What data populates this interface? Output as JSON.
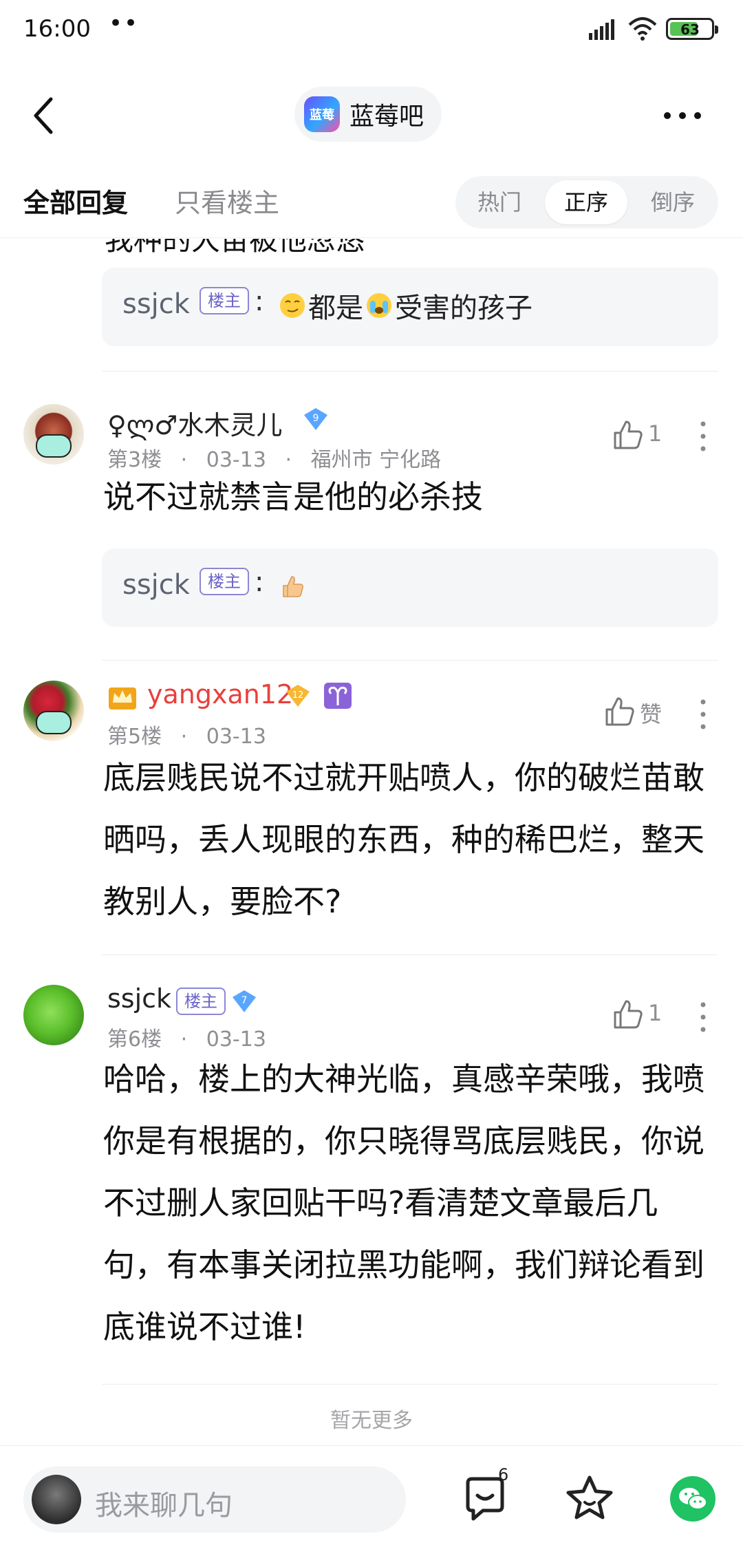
{
  "status_bar": {
    "time": "16:00",
    "dots": "••",
    "battery": "63"
  },
  "nav": {
    "forum_name": "蓝莓吧",
    "forum_logo_text": "蓝莓"
  },
  "filter": {
    "tab_all": "全部回复",
    "tab_op_only": "只看楼主",
    "sort_hot": "热门",
    "sort_asc": "正序",
    "sort_desc": "倒序"
  },
  "clipped_text": "我种的大苗被他忽悠",
  "op_badge": "楼主",
  "reply_1": {
    "author": "ssjck",
    "colon": ":",
    "text_a": "都是",
    "text_b": "受害的孩子"
  },
  "post_3": {
    "username": "♀ლ♂水木灵儿",
    "level": "9",
    "floor": "第3楼",
    "sep": "·",
    "date": "03-13",
    "location": "福州市 宁化路",
    "likes": "1",
    "text": "说不过就禁言是他的必杀技"
  },
  "reply_2": {
    "author": "ssjck",
    "colon": ":"
  },
  "post_5": {
    "username": "yangxan12",
    "level": "12",
    "floor": "第5楼",
    "sep": "·",
    "date": "03-13",
    "like_label": "赞",
    "text": "底层贱民说不过就开贴喷人，你的破烂苗敢晒吗，丢人现眼的东西，种的稀巴烂，整天教别人，要脸不?"
  },
  "post_6": {
    "username": "ssjck",
    "level": "7",
    "floor": "第6楼",
    "sep": "·",
    "date": "03-13",
    "likes": "1",
    "text": "哈哈，楼上的大神光临，真感辛荣哦，我喷你是有根据的，你只晓得骂底层贱民，你说不过删人家回贴干吗?看清楚文章最后几句，有本事关闭拉黑功能啊，我们辩论看到底谁说不过谁!"
  },
  "footer_note": "暂无更多",
  "bottom": {
    "input_placeholder": "我来聊几句",
    "comment_count": "6"
  },
  "colors": {
    "accent_purple": "#6b63c9",
    "vip_red": "#e8403c",
    "wechat_green": "#1fc363",
    "level_blue": "#5aa6ff",
    "level_gold": "#f6b733"
  }
}
